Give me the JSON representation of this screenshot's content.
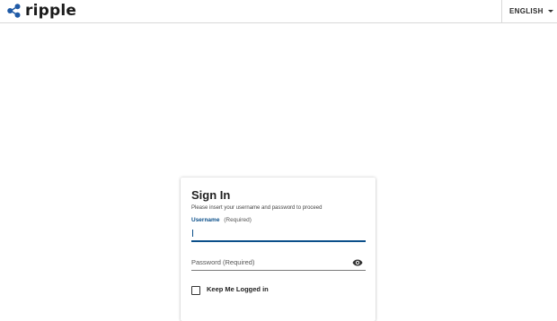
{
  "header": {
    "brand": "ripple",
    "language": "ENGLISH",
    "logo_icon": "ripple-logo-icon",
    "caret_icon": "caret-down-icon"
  },
  "login": {
    "title": "Sign In",
    "subtitle": "Please insert your username and password to proceed",
    "username_label": "Username",
    "username_required": "(Required)",
    "username_value": "",
    "password_placeholder": "Password (Required)",
    "password_value": "",
    "show_password_icon": "eye-icon",
    "keep_logged_in_label": "Keep Me Logged in",
    "keep_logged_in_checked": false
  },
  "colors": {
    "accent": "#0b4f8a",
    "border": "#d9d9d9"
  }
}
